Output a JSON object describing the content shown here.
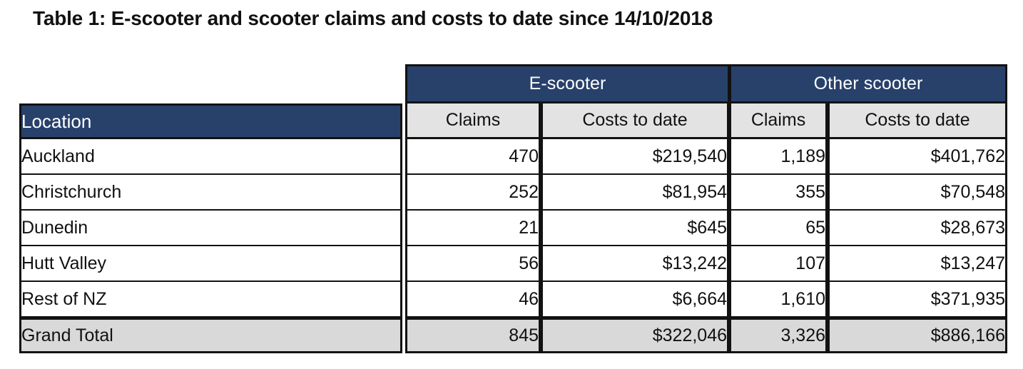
{
  "title": "Table 1: E-scooter and scooter claims and costs to date since 14/10/2018",
  "table": {
    "group_headers": {
      "location_placeholder": "",
      "e_scooter": "E-scooter",
      "other_scooter": "Other scooter"
    },
    "column_headers": {
      "location": "Location",
      "e_claims": "Claims",
      "e_costs": "Costs to date",
      "o_claims": "Claims",
      "o_costs": "Costs to date"
    },
    "rows": [
      {
        "location": "Auckland",
        "e_claims": "470",
        "e_costs": "$219,540",
        "o_claims": "1,189",
        "o_costs": "$401,762"
      },
      {
        "location": "Christchurch",
        "e_claims": "252",
        "e_costs": "$81,954",
        "o_claims": "355",
        "o_costs": "$70,548"
      },
      {
        "location": "Dunedin",
        "e_claims": "21",
        "e_costs": "$645",
        "o_claims": "65",
        "o_costs": "$28,673"
      },
      {
        "location": "Hutt Valley",
        "e_claims": "56",
        "e_costs": "$13,242",
        "o_claims": "107",
        "o_costs": "$13,247"
      },
      {
        "location": "Rest of NZ",
        "e_claims": "46",
        "e_costs": "$6,664",
        "o_claims": "1,610",
        "o_costs": "$371,935"
      }
    ],
    "total_row": {
      "location": "Grand Total",
      "e_claims": "845",
      "e_costs": "$322,046",
      "o_claims": "3,326",
      "o_costs": "$886,166"
    }
  },
  "chart_data": {
    "type": "table",
    "title": "Table 1: E-scooter and scooter claims and costs to date since 14/10/2018",
    "columns": [
      "Location",
      "E-scooter Claims",
      "E-scooter Costs to date",
      "Other scooter Claims",
      "Other scooter Costs to date"
    ],
    "categories": [
      "Auckland",
      "Christchurch",
      "Dunedin",
      "Hutt Valley",
      "Rest of NZ",
      "Grand Total"
    ],
    "series": [
      {
        "name": "E-scooter Claims",
        "values": [
          470,
          252,
          21,
          56,
          46,
          845
        ]
      },
      {
        "name": "E-scooter Costs to date",
        "values": [
          219540,
          81954,
          645,
          13242,
          6664,
          322046
        ]
      },
      {
        "name": "Other scooter Claims",
        "values": [
          1189,
          355,
          65,
          107,
          1610,
          3326
        ]
      },
      {
        "name": "Other scooter Costs to date",
        "values": [
          401762,
          70548,
          28673,
          13247,
          371935,
          886166
        ]
      }
    ],
    "xlabel": "Location",
    "ylabel": "",
    "grid": true,
    "legend": "none"
  },
  "colors": {
    "header_navy": "#28416b",
    "subheader_gray": "#e3e3e3",
    "total_gray": "#d9d9d9",
    "border": "#121212",
    "text": "#111111",
    "page_background": "#ffffff"
  }
}
